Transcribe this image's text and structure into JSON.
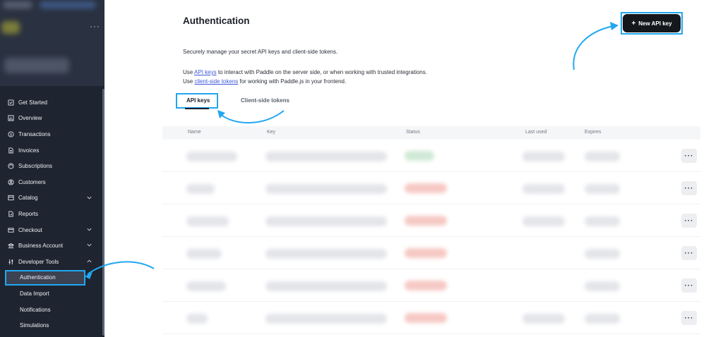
{
  "sidebar": {
    "menu_dots": "···",
    "items": [
      {
        "label": "Get Started",
        "icon": "checklist-icon"
      },
      {
        "label": "Overview",
        "icon": "bar-chart-icon"
      },
      {
        "label": "Transactions",
        "icon": "dollar-circle-icon"
      },
      {
        "label": "Invoices",
        "icon": "document-icon"
      },
      {
        "label": "Subscriptions",
        "icon": "refresh-icon"
      },
      {
        "label": "Customers",
        "icon": "user-circle-icon"
      },
      {
        "label": "Catalog",
        "icon": "box-icon"
      },
      {
        "label": "Reports",
        "icon": "report-icon"
      },
      {
        "label": "Checkout",
        "icon": "card-icon"
      },
      {
        "label": "Business Account",
        "icon": "bank-icon"
      },
      {
        "label": "Developer Tools",
        "icon": "sliders-icon"
      }
    ],
    "sub_items": [
      {
        "label": "Authentication",
        "active": true
      },
      {
        "label": "Data Import",
        "active": false
      },
      {
        "label": "Notifications",
        "active": false
      },
      {
        "label": "Simulations",
        "active": false
      }
    ]
  },
  "page": {
    "title": "Authentication",
    "new_key_label": "New API key",
    "description": "Securely manage your secret API keys and client-side tokens.",
    "desc2_prefix": "Use ",
    "desc2_link1": "API keys",
    "desc2_mid": " to interact with Paddle on the server side, or when working with trusted integrations. Use ",
    "desc2_link2": "client-side tokens",
    "desc2_suffix": " for working with Paddle.js in your frontend."
  },
  "tabs": [
    {
      "label": "API keys",
      "active": true
    },
    {
      "label": "Client-side tokens",
      "active": false
    }
  ],
  "table": {
    "columns": [
      "Name",
      "Key",
      "Status",
      "Last used",
      "Expires"
    ],
    "row_action_label": "···",
    "rows": [
      {
        "status_color": "#cfe9d6"
      },
      {
        "status_color": "#f6c9c4"
      },
      {
        "status_color": "#f6c9c4"
      },
      {
        "status_color": "#f6c9c4"
      },
      {
        "status_color": "#f6c9c4"
      },
      {
        "status_color": "#f6c9c4"
      }
    ]
  },
  "colors": {
    "sidebar_bg": "#1e2430",
    "highlight": "#22a7f0",
    "primary_button": "#14171c",
    "link": "#3d58d8"
  }
}
